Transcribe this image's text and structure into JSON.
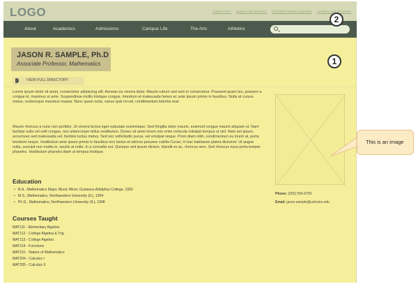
{
  "header": {
    "logo": "LOGO",
    "logo_small": "",
    "utility_links": [
      "DIRECTORY",
      "NEWS AND EVENTS",
      "STUDENT MEDIA CENTER",
      "ALUMNI AND DONORS"
    ]
  },
  "nav": {
    "items": [
      "About",
      "Academics",
      "Admissions",
      "Campus Life",
      "The Arts",
      "Athletics"
    ],
    "search_placeholder": ""
  },
  "callouts": [
    "1",
    "2"
  ],
  "profile": {
    "name": "JASON R. SAMPLE, Ph.D",
    "title": "Associate Professor, Mathematics",
    "directory_button": "VIEW FULL DIRECTORY"
  },
  "bio": [
    "Lorem ipsum dolor sit amet, consectetur adipiscing elit. Aenean eu viverra dolor. Mauris rutrum sed sem in consectetur. Praesent quam leo, posuere a congue id, maximus ut ante. Suspendisse mollis tristique congue. Interdum et malesuada fames ac ante ipsum primis in faucibus. Nulla at cursus metus, scelerisque maximus massa. Nunc quam nulla, varius quis mi vel, condimentum lobortis erat.",
    "Mauris rhoncus a nunc non porttitor. Ut viverra lectus eget vulputate scelerisque. Sed fringilla dolor mauris, euismod congue mauris aliquam ut. Nam facilisis nulla vel velit congue, non ullamcorper tellus vestibulum. Donec sit amet lorem non enim vehicula volutpat tempus ut nisl. Nam est ipsum, accumsan sed malesuada vel, facilisis luctus metus. Sed nec sollicitudin purus, vel volutpat neque. Proin diam nibh, condimentum eu lorem at, porta tincidunt neque. Vestibulum ante ipsum primis in faucibus orci luctus et ultrices posuere cubilia Curae; In hac habitasse platea dictumst. Ut augue nulla, suscipit non mattis in, iaculis at nulla. In a convallis est. Quisque sed ipsum dictum, blandit ex ac, rhoncus sem. Sed rhoncus risus porta tempor pharetra. Vestibulum pharetra diam ut tempus tristique."
  ],
  "education": {
    "heading": "Education",
    "items": [
      "B.A., Mathematics Major, Music Minor, Gustavus Adolphus College, 1992",
      "M.S., Mathematics, Northwestern University (IL), 1994",
      "Ph.D., Mathematics, Northwestern University (IL), 1998"
    ]
  },
  "courses": {
    "heading": "Courses Taught",
    "items": [
      "MAT111 - Elementary Algebra",
      "MAT112 - College Algebra & Trig",
      "MAT113 - College Algebra",
      "MAT114 - Functions",
      "MAT151 - Nature of Mathematics",
      "MAT204 - Calculus I",
      "MAT205 - Calculus II"
    ]
  },
  "contact": {
    "phone_label": "Phone:",
    "phone_value": "(555) 555-6750",
    "email_label": "Email:",
    "email_value": "jason.sample@uchoice.edu"
  },
  "annotation": {
    "tooltip": "This is an image"
  }
}
